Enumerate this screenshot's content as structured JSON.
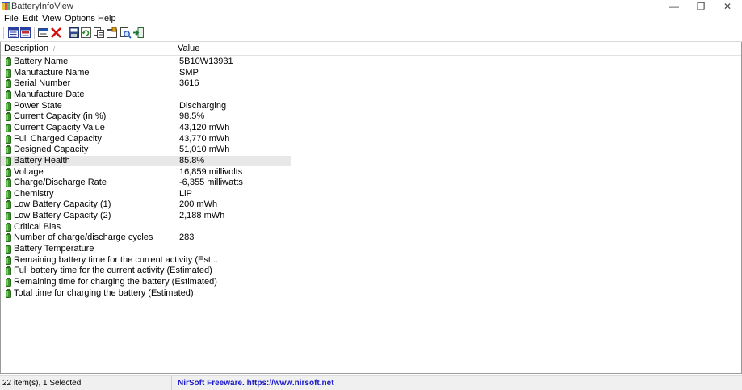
{
  "window": {
    "title": "BatteryInfoView",
    "minimize": "—",
    "restore": "❐",
    "close": "✕"
  },
  "menu": [
    "File",
    "Edit",
    "View",
    "Options",
    "Help"
  ],
  "toolbar": {
    "icons": [
      "html-report-all-icon",
      "html-report-selected-icon",
      "properties-icon",
      "delete-icon",
      "save-icon",
      "refresh-icon",
      "copy-icon",
      "options-icon",
      "find-icon",
      "exit-icon"
    ]
  },
  "columns": {
    "description": "Description",
    "value": "Value",
    "sort_indicator": "/"
  },
  "rows": [
    {
      "description": "Battery Name",
      "value": "5B10W13931"
    },
    {
      "description": "Manufacture Name",
      "value": "SMP"
    },
    {
      "description": "Serial Number",
      "value": " 3616"
    },
    {
      "description": "Manufacture Date",
      "value": ""
    },
    {
      "description": "Power State",
      "value": "Discharging"
    },
    {
      "description": "Current Capacity (in %)",
      "value": "98.5%"
    },
    {
      "description": "Current Capacity Value",
      "value": "43,120 mWh"
    },
    {
      "description": "Full Charged Capacity",
      "value": "43,770 mWh"
    },
    {
      "description": "Designed Capacity",
      "value": "51,010 mWh"
    },
    {
      "description": "Battery Health",
      "value": "85.8%",
      "selected": true
    },
    {
      "description": "Voltage",
      "value": "16,859 millivolts"
    },
    {
      "description": "Charge/Discharge Rate",
      "value": "-6,355 milliwatts"
    },
    {
      "description": "Chemistry",
      "value": "LiP"
    },
    {
      "description": "Low Battery Capacity (1)",
      "value": "200 mWh"
    },
    {
      "description": "Low Battery Capacity (2)",
      "value": "2,188 mWh"
    },
    {
      "description": "Critical Bias",
      "value": ""
    },
    {
      "description": "Number of charge/discharge cycles",
      "value": "283"
    },
    {
      "description": "Battery Temperature",
      "value": ""
    },
    {
      "description": "Remaining battery time for the current activity (Est...",
      "value": ""
    },
    {
      "description": "Full battery time for the current activity (Estimated)",
      "value": ""
    },
    {
      "description": "Remaining time for charging the battery (Estimated)",
      "value": ""
    },
    {
      "description": "Total  time for charging the battery (Estimated)",
      "value": ""
    }
  ],
  "status": {
    "items": "22 item(s), 1 Selected",
    "link": "NirSoft Freeware. https://www.nirsoft.net"
  },
  "colors": {
    "battery_green": "#3c9a2a",
    "link_blue": "#1a1ac8",
    "selected_row": "#e8e8e8"
  }
}
